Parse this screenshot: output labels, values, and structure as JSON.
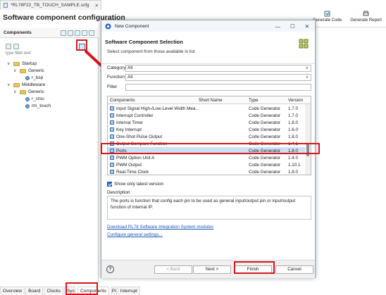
{
  "editor_tab": {
    "label": "*RL78F22_TB_TOUCH_SAMPLE.scfg"
  },
  "page_title": "Software component configuration",
  "toolbar": {
    "generate_code": "Generate Code",
    "generate_report": "Generate Report"
  },
  "components_panel": {
    "title": "Components",
    "filter_placeholder": "type filter text",
    "tree": [
      {
        "label": "Startup"
      },
      {
        "label": "Generic"
      },
      {
        "label": "r_bsp"
      },
      {
        "label": "Middleware"
      },
      {
        "label": "Generic"
      },
      {
        "label": "r_ctsu"
      },
      {
        "label": "rm_touch"
      }
    ]
  },
  "bottom_tabs": [
    "Overview",
    "Board",
    "Clocks",
    "System",
    "Components",
    "Pins",
    "Interrupt"
  ],
  "dialog": {
    "window_title": "New Component",
    "heading": "Software Component Selection",
    "subheading": "Select component from those available in list",
    "category_label": "Category",
    "category_value": "All",
    "function_label": "Function",
    "function_value": "All",
    "filter_label": "Filter",
    "filter_value": "",
    "columns": {
      "components": "Components",
      "short_name": "Short Name",
      "type": "Type",
      "version": "Version"
    },
    "rows": [
      {
        "name": "Input Signal High-/Low-Level Width Mea...",
        "short": "",
        "type": "Code Generator",
        "version": "1.7.0"
      },
      {
        "name": "Interrupt Controller",
        "short": "",
        "type": "Code Generator",
        "version": "1.7.0"
      },
      {
        "name": "Interval Timer",
        "short": "",
        "type": "Code Generator",
        "version": "1.8.0"
      },
      {
        "name": "Key Interrupt",
        "short": "",
        "type": "Code Generator",
        "version": "1.6.0"
      },
      {
        "name": "One-Shot Pulse Output",
        "short": "",
        "type": "Code Generator",
        "version": "1.8.0"
      },
      {
        "name": "Output Compare Function",
        "short": "",
        "type": "Code Generator",
        "version": "1.4.1"
      },
      {
        "name": "Ports",
        "short": "",
        "type": "Code Generator",
        "version": "1.8.0"
      },
      {
        "name": "PWM Option Unit A",
        "short": "",
        "type": "Code Generator",
        "version": "1.4.0"
      },
      {
        "name": "PWM Output",
        "short": "",
        "type": "Code Generator",
        "version": "1.10.1"
      },
      {
        "name": "Real-Time Clock",
        "short": "",
        "type": "Code Generator",
        "version": "1.8.0"
      }
    ],
    "show_latest_label": "Show only latest version",
    "show_latest_checked": true,
    "description_label": "Description",
    "description_text": "The ports is function that config each pin to be used as general input/output pin or input/output function of internal IP.",
    "link_download": "Download RL78 Software Integration System modules",
    "link_configure": "Configure general settings...",
    "buttons": {
      "back": "< Back",
      "next": "Next >",
      "finish": "Finish",
      "cancel": "Cancel"
    }
  },
  "colors": {
    "highlight": "#d8151b",
    "selection": "#cce0f5",
    "link": "#1a58b3"
  }
}
